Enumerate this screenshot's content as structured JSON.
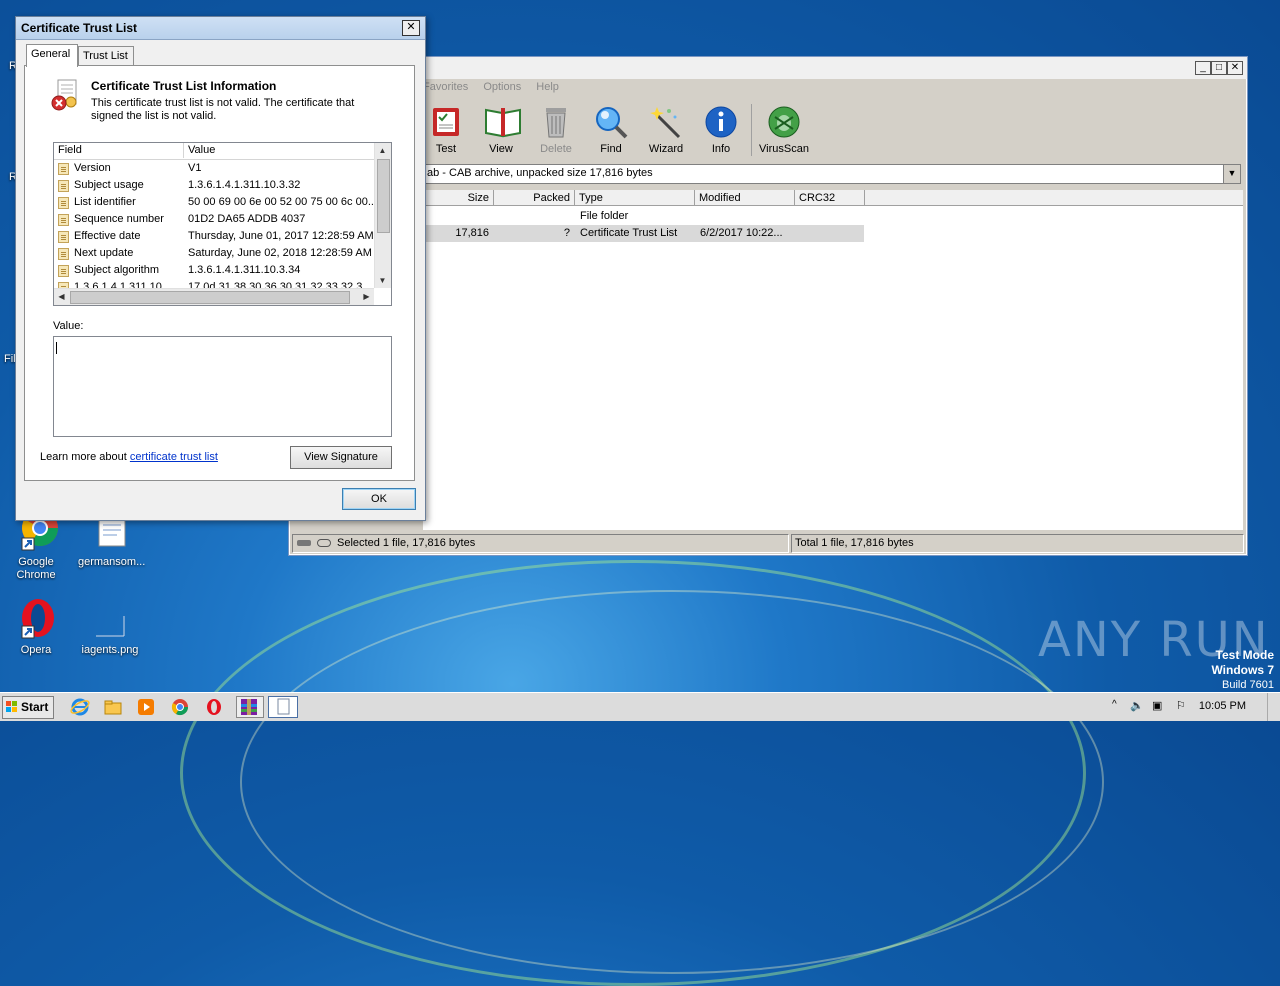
{
  "dialog": {
    "title": "Certificate Trust List",
    "close_glyph": "✕",
    "tabs": [
      {
        "label": "General",
        "active": true
      },
      {
        "label": "Trust List",
        "active": false
      }
    ],
    "info_title": "Certificate Trust List Information",
    "info_body": "This certificate trust list is not valid.  The certificate that signed the list is not valid.",
    "columns": {
      "field": "Field",
      "value": "Value"
    },
    "rows": [
      {
        "field": "Version",
        "value": "V1"
      },
      {
        "field": "Subject usage",
        "value": "1.3.6.1.4.1.311.10.3.32"
      },
      {
        "field": "List identifier",
        "value": "50 00 69 00 6e 00 52 00 75 00 6c 00..."
      },
      {
        "field": "Sequence number",
        "value": "01D2 DA65 ADDB 4037"
      },
      {
        "field": "Effective date",
        "value": "Thursday, June 01, 2017 12:28:59 AM"
      },
      {
        "field": "Next update",
        "value": "Saturday, June 02, 2018 12:28:59 AM"
      },
      {
        "field": "Subject algorithm",
        "value": "1.3.6.1.4.1.311.10.3.34"
      },
      {
        "field": "1.3.6.1.4.1.311.10...",
        "value": "17 0d 31 38 30 36 30 31 32 33 32 3..."
      }
    ],
    "value_label": "Value:",
    "value_text": "",
    "learn_prefix": "Learn more about ",
    "learn_link": "certificate trust list",
    "view_signature": "View Signature",
    "ok": "OK"
  },
  "winrar": {
    "menu": [
      "Favorites",
      "Options",
      "Help"
    ],
    "tools": [
      {
        "label": "Test",
        "icon": "test-icon",
        "enabled": true
      },
      {
        "label": "View",
        "icon": "view-icon",
        "enabled": true
      },
      {
        "label": "Delete",
        "icon": "delete-icon",
        "enabled": false
      },
      {
        "label": "Find",
        "icon": "find-icon",
        "enabled": true
      },
      {
        "label": "Wizard",
        "icon": "wizard-icon",
        "enabled": true
      },
      {
        "label": "Info",
        "icon": "info-icon",
        "enabled": true
      },
      {
        "label": "VirusScan",
        "icon": "virusscan-icon",
        "enabled": true
      }
    ],
    "path": "ab - CAB archive, unpacked size 17,816 bytes",
    "columns": [
      "Size",
      "Packed",
      "Type",
      "Modified",
      "CRC32"
    ],
    "files": [
      {
        "size": "",
        "packed": "",
        "type": "File folder",
        "modified": "",
        "crc": "",
        "selected": false
      },
      {
        "size": "17,816",
        "packed": "?",
        "type": "Certificate Trust List",
        "modified": "6/2/2017 10:22...",
        "crc": "",
        "selected": true
      }
    ],
    "status_left": "Selected 1 file, 17,816 bytes",
    "status_right": "Total 1 file, 17,816 bytes"
  },
  "desktop": {
    "icons": [
      {
        "label": "Google Chrome",
        "icon": "chrome-icon"
      },
      {
        "label": "germansom...",
        "icon": "document-icon"
      },
      {
        "label": "Opera",
        "icon": "opera-icon"
      },
      {
        "label": "iagents.png",
        "icon": "image-file-icon"
      }
    ],
    "partial_labels": [
      "R",
      "R",
      "Fil"
    ],
    "watermark": "ANY RUN",
    "test_mode": {
      "line1": "Test Mode",
      "line2": "Windows 7",
      "line3": "Build 7601"
    }
  },
  "taskbar": {
    "start": "Start",
    "clock": "10:05 PM",
    "items": [
      "ie-icon",
      "explorer-icon",
      "media-player-icon",
      "chrome-icon",
      "opera-icon",
      "winrar-icon",
      "document-icon"
    ]
  },
  "colors": {
    "accent": "#3c7fb1",
    "link": "#0033cc",
    "selection": "#d9d9d9"
  }
}
